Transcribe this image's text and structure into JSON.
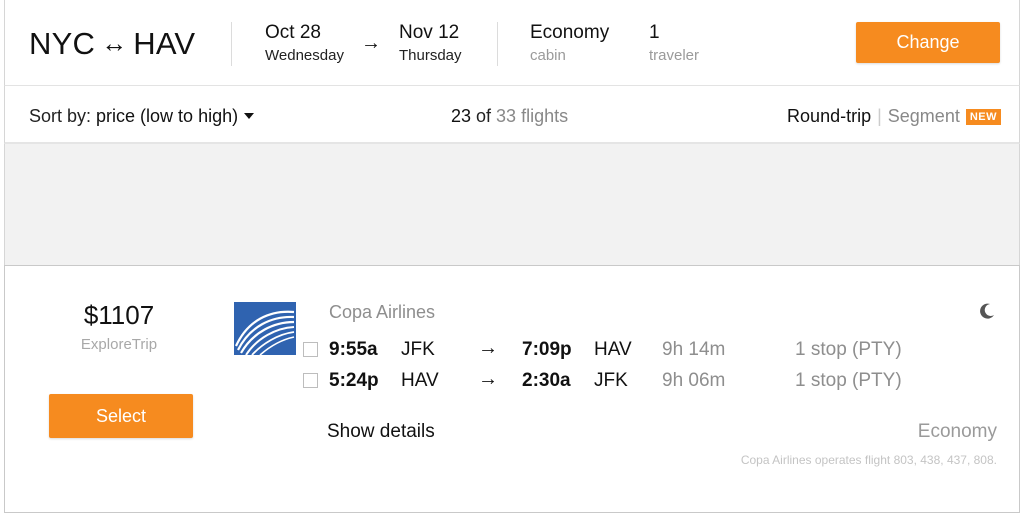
{
  "search": {
    "origin": "NYC",
    "route_arrow": "↔",
    "destination": "HAV",
    "depart_date": "Oct 28",
    "depart_day": "Wednesday",
    "date_arrow": "→",
    "return_date": "Nov 12",
    "return_day": "Thursday",
    "cabin_value": "Economy",
    "cabin_label": "cabin",
    "travelers_value": "1",
    "travelers_label": "traveler",
    "change_label": "Change"
  },
  "sort_bar": {
    "sort_prefix": "Sort by: ",
    "sort_value": "price (low to high)",
    "shown_count": "23",
    "of_label": " of ",
    "total_label": "33 flights",
    "roundtrip_label": "Round-trip",
    "divider": "|",
    "segment_label": "Segment",
    "new_badge": "NEW"
  },
  "result": {
    "price": "$1107",
    "provider": "ExploreTrip",
    "select_label": "Select",
    "airline": "Copa Airlines",
    "overnight_icon": "moon-icon",
    "legs": [
      {
        "depart_time": "9:55a",
        "from": "JFK",
        "arrow": "→",
        "arrive_time": "7:09p",
        "to": "HAV",
        "duration": "9h 14m",
        "stops": "1 stop (PTY)"
      },
      {
        "depart_time": "5:24p",
        "from": "HAV",
        "arrow": "→",
        "arrive_time": "2:30a",
        "to": "JFK",
        "duration": "9h 06m",
        "stops": "1 stop (PTY)"
      }
    ],
    "details_label": "Show details",
    "cabin_class": "Economy",
    "operates_note": "Copa Airlines operates flight 803, 438, 437, 808."
  },
  "colors": {
    "accent": "#f68b1f",
    "logo_blue": "#2f63b0",
    "muted_text": "#8e8e8e",
    "gap_background": "#f2f2f2"
  }
}
